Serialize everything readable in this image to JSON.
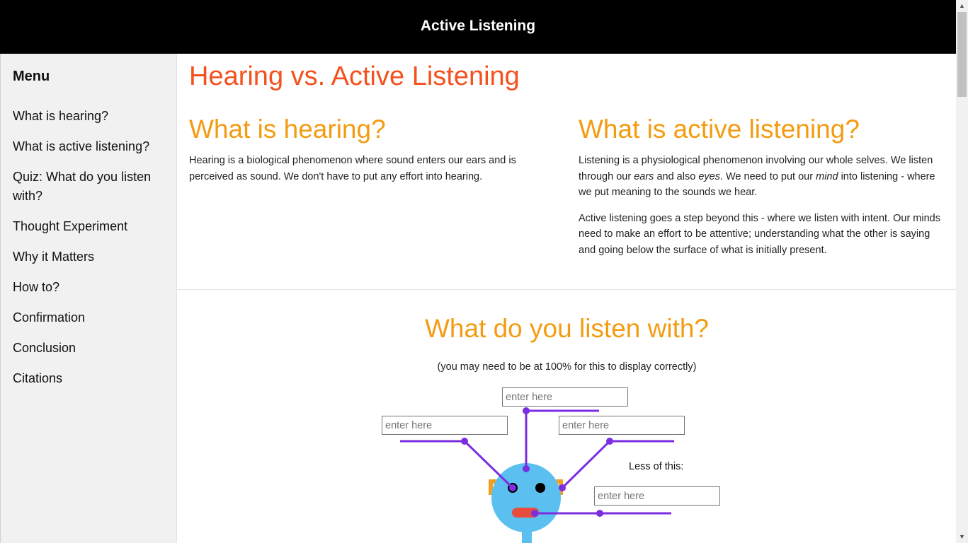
{
  "header": {
    "title": "Active Listening"
  },
  "sidebar": {
    "title": "Menu",
    "items": [
      {
        "label": "What is hearing?"
      },
      {
        "label": "What is active listening?"
      },
      {
        "label": "Quiz: What do you listen with?"
      },
      {
        "label": "Thought Experiment"
      },
      {
        "label": "Why it Matters"
      },
      {
        "label": "How to?"
      },
      {
        "label": "Confirmation"
      },
      {
        "label": "Conclusion"
      },
      {
        "label": "Citations"
      }
    ]
  },
  "main": {
    "title": "Hearing vs. Active Listening",
    "hearing": {
      "heading": "What is hearing?",
      "paragraph": "Hearing is a biological phenomenon where sound enters our ears and is perceived as sound. We don't have to put any effort into hearing."
    },
    "listening": {
      "heading": "What is active listening?",
      "p1_a": "Listening is a physiological phenomenon involving our whole selves. We listen through our ",
      "p1_ears": "ears",
      "p1_b": " and also ",
      "p1_eyes": "eyes",
      "p1_c": ". We need to put our ",
      "p1_mind": "mind",
      "p1_d": " into listening - where we put meaning to the sounds we hear.",
      "p2": "Active listening goes a step beyond this - where we listen with intent. Our minds need to make an effort to be attentive; understanding what the other is saying and going below the surface of what is initially present."
    },
    "quiz": {
      "heading": "What do you listen with?",
      "note": "(you may need to be at 100% for this to display correctly)",
      "input_placeholder": "enter here",
      "less_label": "Less of this:"
    }
  },
  "colors": {
    "title_orange_red": "#f4511e",
    "heading_orange": "#f39c12",
    "pointer_purple": "#7a2ee0",
    "face_blue": "#5bc0f0",
    "mouth_red": "#e74c3c",
    "ear_orange": "#f0a020"
  }
}
